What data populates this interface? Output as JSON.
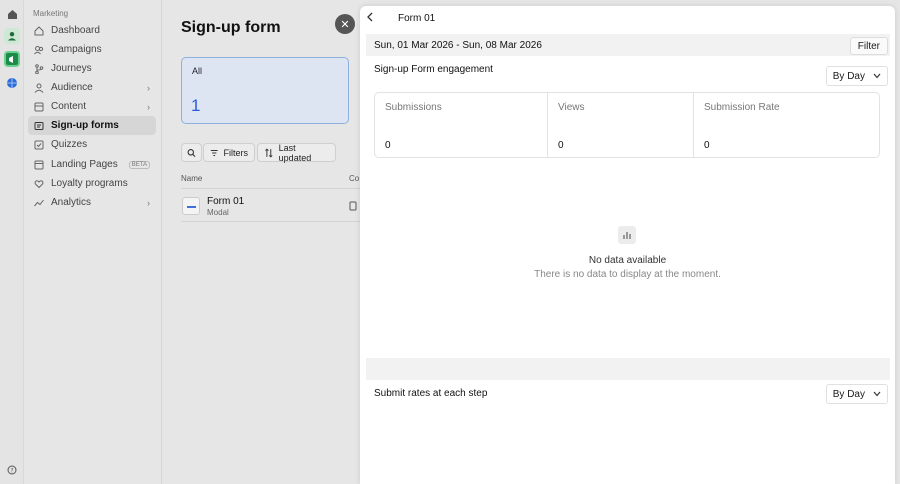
{
  "rail": {
    "icons": [
      "home-icon",
      "user-icon",
      "megaphone-icon",
      "globe-icon",
      "help-icon"
    ]
  },
  "sidebar": {
    "section": "Marketing",
    "items": [
      {
        "label": "Dashboard",
        "icon": "home-icon"
      },
      {
        "label": "Campaigns",
        "icon": "users-icon"
      },
      {
        "label": "Journeys",
        "icon": "branch-icon"
      },
      {
        "label": "Audience",
        "icon": "person-icon",
        "chevron": "›"
      },
      {
        "label": "Content",
        "icon": "content-icon",
        "chevron": "›"
      },
      {
        "label": "Sign-up forms",
        "icon": "form-icon",
        "active": true
      },
      {
        "label": "Quizzes",
        "icon": "quiz-icon"
      },
      {
        "label": "Landing Pages",
        "icon": "page-icon",
        "badge": "BETA"
      },
      {
        "label": "Loyalty programs",
        "icon": "heart-icon"
      },
      {
        "label": "Analytics",
        "icon": "analytics-icon",
        "chevron": "›"
      }
    ]
  },
  "main": {
    "title": "Sign-up form",
    "stat": {
      "label": "All",
      "value": "1"
    },
    "toolbar": {
      "filters": "Filters",
      "sort": "Last updated"
    },
    "columns": {
      "name": "Name",
      "content": "Co"
    },
    "row": {
      "name": "Form 01",
      "type": "Modal"
    }
  },
  "panel": {
    "title": "Form 01",
    "date_range": "Sun, 01 Mar 2026 - Sun, 08 Mar 2026",
    "filter_label": "Filter",
    "engagement_title": "Sign-up Form engagement",
    "by_day": "By Day",
    "metrics": [
      {
        "label": "Submissions",
        "value": "0"
      },
      {
        "label": "Views",
        "value": "0"
      },
      {
        "label": "Submission Rate",
        "value": "0"
      }
    ],
    "empty_title": "No data available",
    "empty_subtitle": "There is no data to display at the moment.",
    "steps_title": "Submit rates at each step",
    "steps_by_day": "By Day"
  },
  "colors": {
    "accent": "#2a5bd7",
    "active_card_bg": "#dde5f2"
  }
}
